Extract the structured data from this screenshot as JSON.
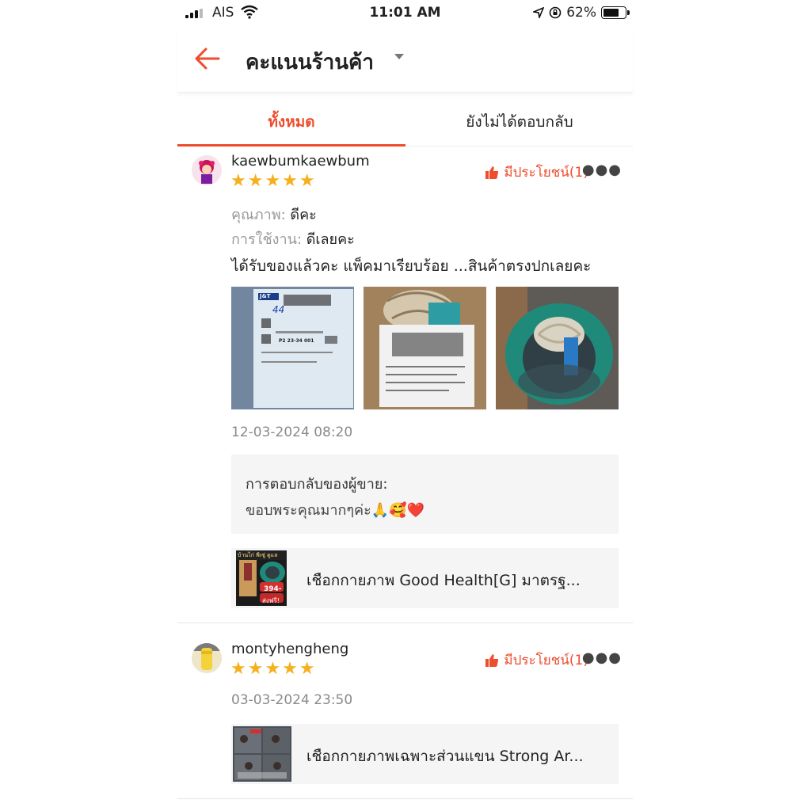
{
  "status_bar": {
    "carrier": "AIS",
    "time": "11:01 AM",
    "battery": "62%"
  },
  "header": {
    "title": "คะแนนร้านค้า"
  },
  "tabs": [
    {
      "label": "ทั้งหมด",
      "active": true
    },
    {
      "label": "ยังไม่ได้ตอบกลับ",
      "active": false
    }
  ],
  "reviews": [
    {
      "username": "kaewbumkaewbum",
      "stars": "★★★★★",
      "rating": 5,
      "helpful": "มีประโยชน์(1)",
      "attributes": [
        {
          "label": "คุณภาพ:",
          "value": "ดีคะ"
        },
        {
          "label": "การใช้งาน:",
          "value": "ดีเลยคะ"
        }
      ],
      "comment": "ได้รับของแล้วคะ แพ็คมาเรียบร้อย ...สินค้าตรงปกเลยคะ",
      "photos": [
        {
          "label": "J&T",
          "code": "P2 23-34 001",
          "number": "44"
        },
        {
          "desc": ""
        },
        {
          "desc": ""
        }
      ],
      "date": "12-03-2024 08:20",
      "seller_reply": {
        "title": "การตอบกลับของผู้ขาย:",
        "body": "ขอบพระคุณมากๆค่ะ🙏🥰❤️"
      },
      "product": {
        "thumb_top": "บ้านไก่ พีเซู่ ดูแล",
        "thumb_price": "394-",
        "thumb_ship": "ส่งฟรี!",
        "name": "เชือกกายภาพ Good Health[G] มาตรฐ..."
      }
    },
    {
      "username": "montyhengheng",
      "stars": "★★★★★",
      "rating": 5,
      "helpful": "มีประโยชน์(1)",
      "date": "03-03-2024 23:50",
      "product": {
        "name": "เชือกกายภาพเฉพาะส่วนแขน Strong Ar..."
      }
    }
  ],
  "colors": {
    "accent": "#ee4d2d",
    "star": "#f6b01e"
  }
}
